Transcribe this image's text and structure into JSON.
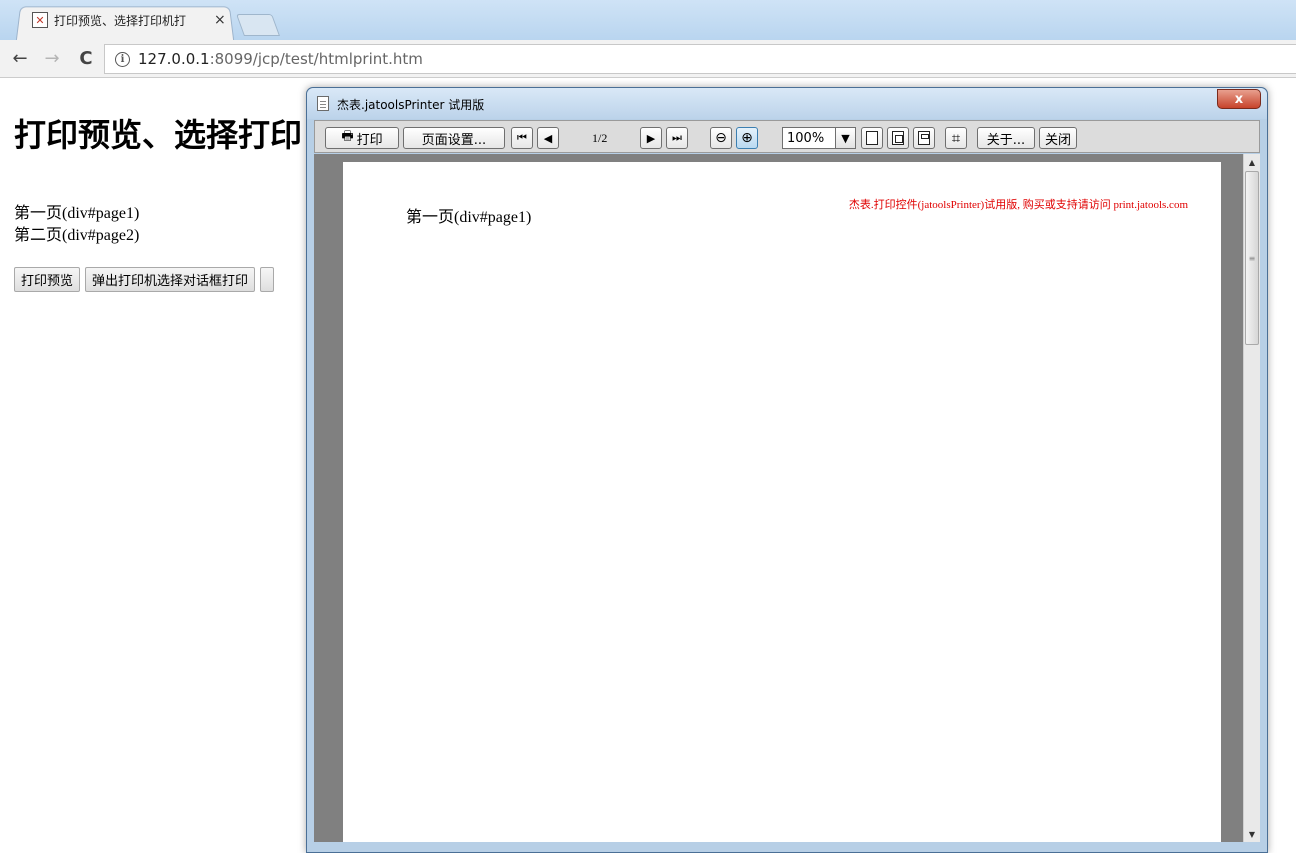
{
  "browser": {
    "tab_title": "打印预览、选择打印机打",
    "tab_close": "×",
    "nav": {
      "back": "←",
      "forward": "→",
      "reload": "C"
    },
    "url_info_icon": "i",
    "url_host": "127.0.0.1",
    "url_rest": ":8099/jcp/test/htmlprint.htm"
  },
  "page": {
    "title": "打印预览、选择打印",
    "lines": [
      "第一页(div#page1)",
      "第二页(div#page2)"
    ],
    "buttons": [
      "打印预览",
      "弹出打印机选择对话框打印"
    ]
  },
  "preview_window": {
    "title": "杰表.jatoolsPrinter 试用版",
    "close": "x",
    "toolbar": {
      "print": "打印",
      "print_icon": "🖶",
      "page_setup": "页面设置...",
      "first": "⏮",
      "prev": "◀",
      "page_indicator": "1/2",
      "next": "▶",
      "last": "⏭",
      "zoom_out": "⊖",
      "zoom_in": "⊕",
      "zoom": "100%",
      "zoom_arrow": "▼",
      "fit_icon": "⌗",
      "about": "关于...",
      "close": "关闭"
    },
    "paper_text": "第一页(div#page1)",
    "trial_notice": "杰表.打印控件(jatoolsPrinter)试用版, 购买或支持请访问  print.jatools.com",
    "scroll_up": "▲",
    "scroll_down": "▼",
    "scroll_grip": "≡"
  },
  "colors": {
    "trial_notice": "#e00000",
    "viewport_bg": "#808080",
    "window_frame": "#b7cfe6"
  }
}
